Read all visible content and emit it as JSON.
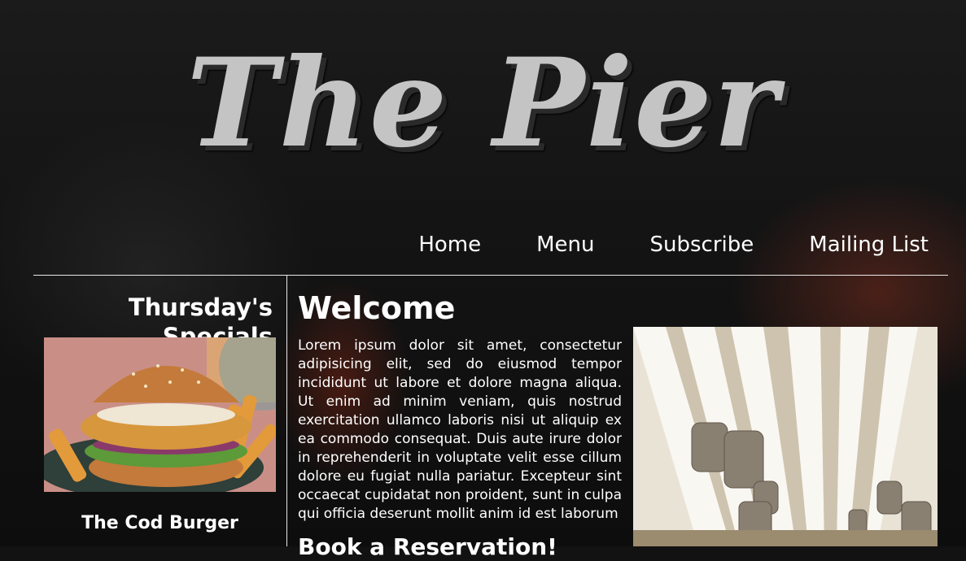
{
  "brand": {
    "logo_text": "The Pier"
  },
  "nav": {
    "items": [
      "Home",
      "Menu",
      "Subscribe",
      "Mailing List"
    ]
  },
  "specials": {
    "title": "Thursday's Specials",
    "item_name": "The Cod Burger"
  },
  "main": {
    "heading": "Welcome",
    "body": "Lorem ipsum dolor sit amet, consectetur adipisicing elit, sed do eiusmod tempor incididunt ut labore et dolore magna aliqua. Ut enim ad minim veniam, quis nostrud exercitation ullamco laboris nisi ut aliquip ex ea commodo consequat. Duis aute irure dolor in reprehenderit in voluptate velit esse cillum dolore eu fugiat nulla pariatur. Excepteur sint occaecat cupidatat non proident, sunt in culpa qui officia deserunt mollit anim id est laborum",
    "subheading": "Book a Reservation!"
  },
  "colors": {
    "logo": "#c4c4c4",
    "text": "#ffffff",
    "rules": "#e8e8e8"
  }
}
